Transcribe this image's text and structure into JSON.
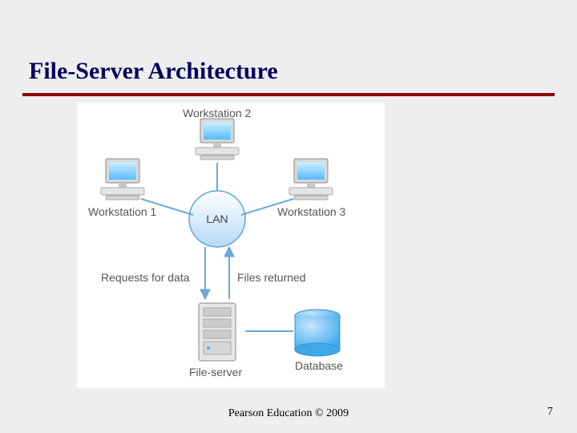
{
  "title": "File-Server Architecture",
  "footer": "Pearson Education © 2009",
  "page_number": "7",
  "diagram": {
    "workstation1": "Workstation 1",
    "workstation2": "Workstation 2",
    "workstation3": "Workstation 3",
    "lan": "LAN",
    "requests": "Requests for data",
    "files_returned": "Files returned",
    "file_server": "File-server",
    "database": "Database"
  }
}
